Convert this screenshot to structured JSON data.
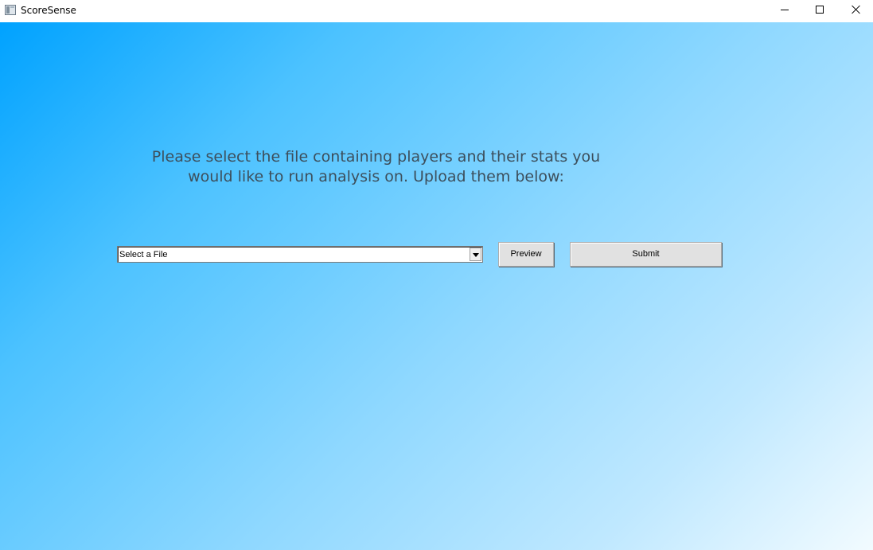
{
  "window": {
    "title": "ScoreSense",
    "controls": {
      "minimize": "minimize-icon",
      "maximize": "maximize-icon",
      "close": "close-icon"
    }
  },
  "main": {
    "prompt": "Please select the file containing players and their stats you\nwould like to run analysis on. Upload them below:",
    "file_select": {
      "value": "Select a File"
    },
    "preview_label": "Preview",
    "submit_label": "Submit"
  },
  "colors": {
    "gradient_start": "#00a2ff",
    "gradient_end": "#f2fbff",
    "prompt_text": "#3d4f5c"
  }
}
